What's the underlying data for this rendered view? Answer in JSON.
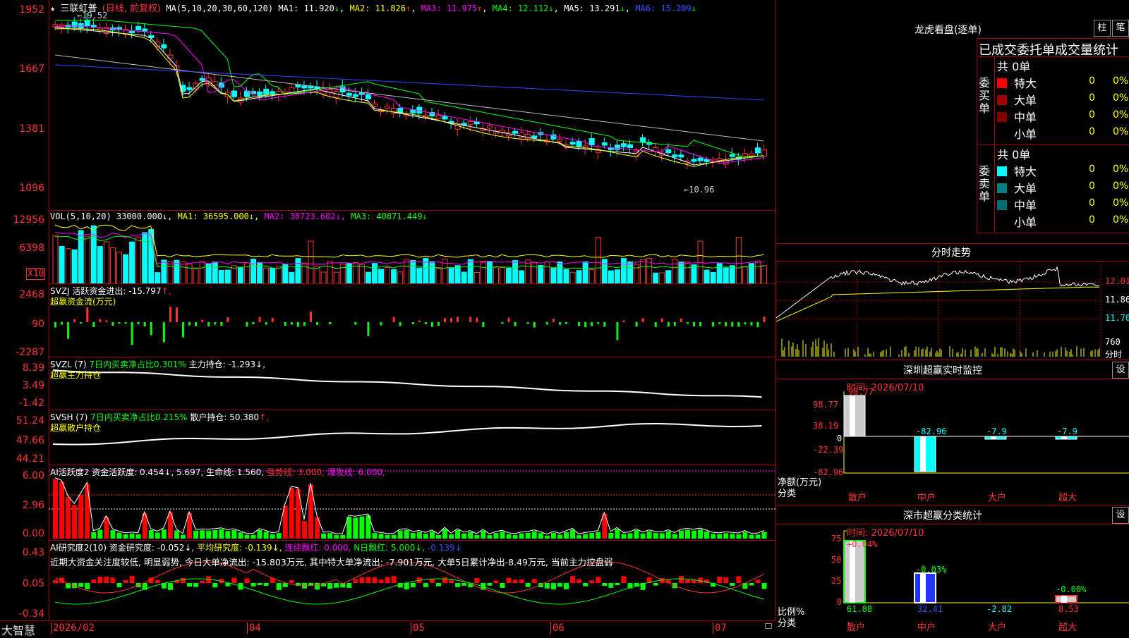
{
  "stock": {
    "star": "★",
    "name": "三联虹普",
    "period": "(日线, 前复权)"
  },
  "main": {
    "ma_header": [
      "MA(5,10,20,30,60,120)"
    ],
    "ma": [
      {
        "label": "MA1: 11.920",
        "arrow": "↓",
        "color": "#ffffff"
      },
      {
        "label": "MA2: 11.826",
        "arrow": "↑",
        "color": "#ffff00"
      },
      {
        "label": "MA3: 11.975",
        "arrow": "↑",
        "color": "#ff00ff"
      },
      {
        "label": "MA4: 12.112",
        "arrow": "↓",
        "color": "#00ff00"
      },
      {
        "label": "MA5: 13.291",
        "arrow": "↓",
        "color": "#ffffff"
      },
      {
        "label": "MA6: 15.209",
        "arrow": "↓",
        "color": "#0000ff"
      }
    ],
    "yticks": [
      "1952",
      "1667",
      "1381",
      "1096"
    ],
    "high_label": "←19.52",
    "low_label": "←10.96"
  },
  "vol": {
    "title": "VOL(5,10,20) 33000.000↓,",
    "ma1": "MA1: 36595.000↓,",
    "ma2": "MA2: 38723.602↓,",
    "ma3": "MA3: 40871.449↓",
    "yticks": [
      "12956",
      "6398"
    ],
    "unit": "X10"
  },
  "svzj": {
    "title": "SVZJ  活跃资金进出: -15.797",
    "arrow": "↑,",
    "sub": "超赢资金流(万元)",
    "yticks": [
      "2468",
      "90",
      "-2287"
    ]
  },
  "svzl": {
    "title": "SVZL (7)",
    "ratio": "7日内买卖净占比0.301%",
    "hold": "主力持仓: -1.293↓,",
    "sub": "超赢主力持仓",
    "yticks": [
      "8.39",
      "3.49",
      "-1.42"
    ]
  },
  "svsh": {
    "title": "SVSH (7)",
    "ratio": "7日内买卖净占比0.215%",
    "hold": "散户持仓: 50.380",
    "arrow": "↑,",
    "sub": "超赢散户持仓",
    "yticks": [
      "51.24",
      "47.66",
      "44.21"
    ]
  },
  "ai1": {
    "title": "AI活跃度2 资金活跃度: 0.454↓, 5.697, 生命线: 1.560,",
    "strong": "强势线: 3.000,",
    "burst": "爆发线: 6.000,",
    "yticks": [
      "6.00",
      "2.96",
      "0.00"
    ]
  },
  "ai2": {
    "title": "AI研究度2(10) 资金研究度: -0.052↓,",
    "avg": "平均研究度: -0.139↓,",
    "red": "连续飘红: 0.000,",
    "nred": "N日飘红: 5.000↓,",
    "last": "-0.139↓",
    "comment": "近期大资金关注度较低, 明显弱势, 今日大单净流出: -15.803万元, 其中特大单净流出: -7.901万元, 大单5日累计净出-8.49万元, 当前主力控盘弱",
    "yticks": [
      "0.43",
      "0.05",
      "-0.34"
    ]
  },
  "xaxis": {
    "brand": "大智慧",
    "labels": [
      "2026/02",
      "04",
      "05",
      "06",
      "07"
    ]
  },
  "right": {
    "dragon_title": "龙虎看盘(逐单)",
    "btn_bar": "柱",
    "btn_pen": "笔",
    "stat_title": "已成交委托单成交量统计",
    "buy_label": "委买单",
    "sell_label": "委卖单",
    "buy_total": "共 0单",
    "sell_total": "共 0单",
    "buy_rows": [
      {
        "name": "特大",
        "v": "0",
        "p": "0%",
        "color": "#ff0000"
      },
      {
        "name": "大单",
        "v": "0",
        "p": "0%",
        "color": "#a00000"
      },
      {
        "name": "中单",
        "v": "0",
        "p": "0%",
        "color": "#800000"
      },
      {
        "name": "小单",
        "v": "0",
        "p": "0%",
        "color": ""
      }
    ],
    "sell_rows": [
      {
        "name": "特大",
        "v": "0",
        "p": "0%",
        "color": "#00ffff"
      },
      {
        "name": "大单",
        "v": "0",
        "p": "0%",
        "color": "#008080"
      },
      {
        "name": "中单",
        "v": "0",
        "p": "0%",
        "color": "#006e6e"
      },
      {
        "name": "小单",
        "v": "0",
        "p": "0%",
        "color": ""
      }
    ],
    "fenshi_title": "分时走势",
    "fenshi_y": [
      "12.01",
      "11.86",
      "11.70"
    ],
    "fenshi_vol": "760",
    "fenshi_unit": "分时",
    "sz_title": "深圳超赢实时监控",
    "sz_set": "设",
    "sz_time": "时间: 2026/07/10",
    "sz_y": [
      "98.77",
      "38.19",
      "0",
      "-22.39",
      "-82.96"
    ],
    "sz_vals": [
      "98.77",
      "-82.96",
      "-7.9",
      "-7.9"
    ],
    "sz_ylabel": "净额(万元)",
    "sz_xlabel": "分类",
    "cats": [
      "散户",
      "中户",
      "大户",
      "超大"
    ],
    "cls_title": "深市超赢分类统计",
    "cls_set": "设",
    "cls_time": "时间: 2026/07/10",
    "cls_y": [
      "75",
      "50",
      "25",
      "0"
    ],
    "cls_top": [
      "+0.04%",
      "-0.03%",
      "",
      "-0.00%"
    ],
    "cls_bottom": [
      "61.88",
      "32.41",
      "-2.82",
      "8.53"
    ],
    "cls_ylabel": "比例%",
    "cls_xlabel": "分类"
  }
}
